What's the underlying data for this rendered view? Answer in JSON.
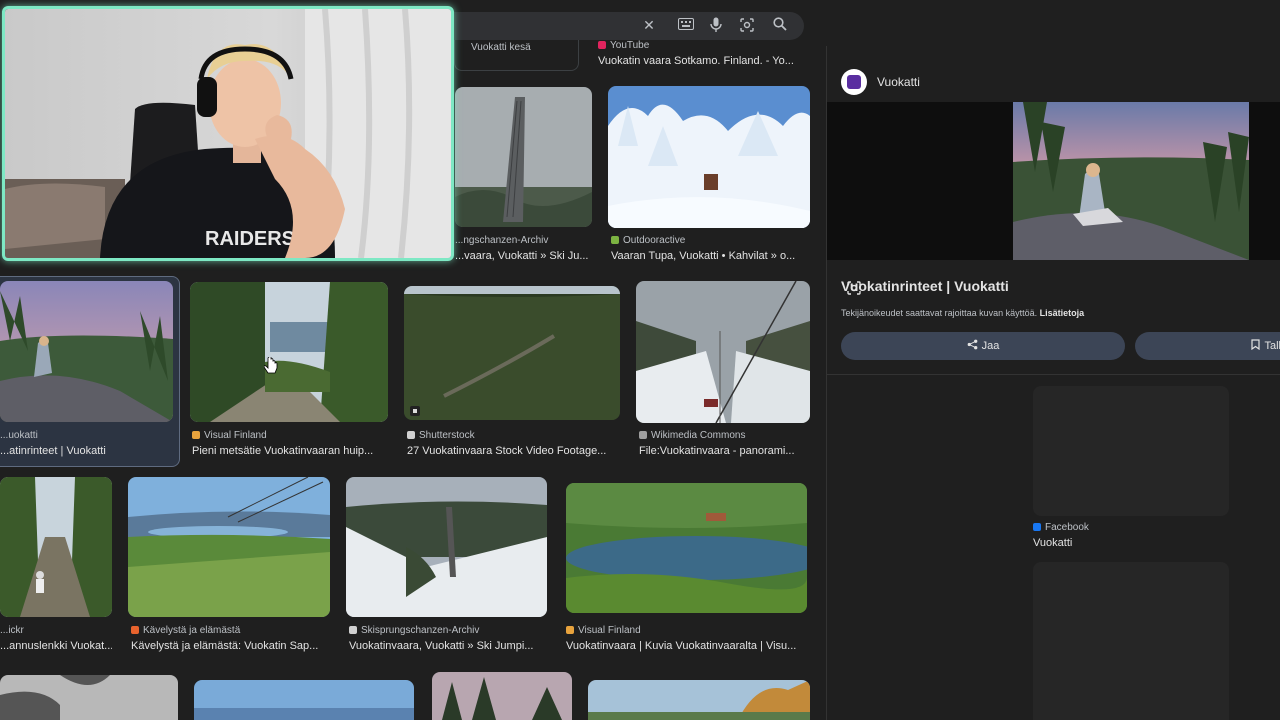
{
  "search": {
    "clear_icon": "close-icon",
    "keyboard_icon": "keyboard-icon",
    "mic_icon": "mic-icon",
    "lens_icon": "camera-lens-icon",
    "search_icon": "search-icon"
  },
  "related_chip": {
    "label": "Vuokatti kesä"
  },
  "top_result": {
    "source": "YouTube",
    "title": "Vuokatin vaara Sotkamo. Finland. - Yo..."
  },
  "results_row1": [
    {
      "source": "...ngschanzen-Archiv",
      "title": "...vaara, Vuokatti » Ski Ju..."
    },
    {
      "source": "Outdooractive",
      "title": "Vaaran Tupa, Vuokatti • Kahvilat » o..."
    }
  ],
  "results_row2": [
    {
      "source": "...uokatti",
      "title": "...atinrinteet | Vuokatti"
    },
    {
      "source": "Visual Finland",
      "title": "Pieni metsätie Vuokatinvaaran huip..."
    },
    {
      "source": "Shutterstock",
      "title": "27 Vuokatinvaara Stock Video Footage..."
    },
    {
      "source": "Wikimedia Commons",
      "title": "File:Vuokatinvaara - panorami..."
    }
  ],
  "results_row3": [
    {
      "source": "...ickr",
      "title": "...annuslenkki Vuokat..."
    },
    {
      "source": "Kävelystä ja elämästä",
      "title": "Kävelystä ja elämästä: Vuokatin Sap..."
    },
    {
      "source": "Skisprungschanzen-Archiv",
      "title": "Vuokatinvaara, Vuokatti » Ski Jumpi..."
    },
    {
      "source": "Visual Finland",
      "title": "Vuokatinvaara | Kuvia Vuokatinvaaralta | Visu..."
    }
  ],
  "panel": {
    "site": "Vuokatti",
    "title": "Vuokatinrinteet | Vuokatti",
    "note": "Tekijänoikeudet saattavat rajoittaa kuvan käyttöä.",
    "note_link": "Lisätietoja",
    "share_label": "Jaa",
    "save_label": "Tall",
    "related_source": "Facebook",
    "related_title": "Vuokatti"
  },
  "webcam": {
    "shirt_text": "RAIDERS"
  },
  "colors": {
    "accent_border": "#7ee8c4",
    "background": "#1f1f1f",
    "button": "#3c4556"
  }
}
